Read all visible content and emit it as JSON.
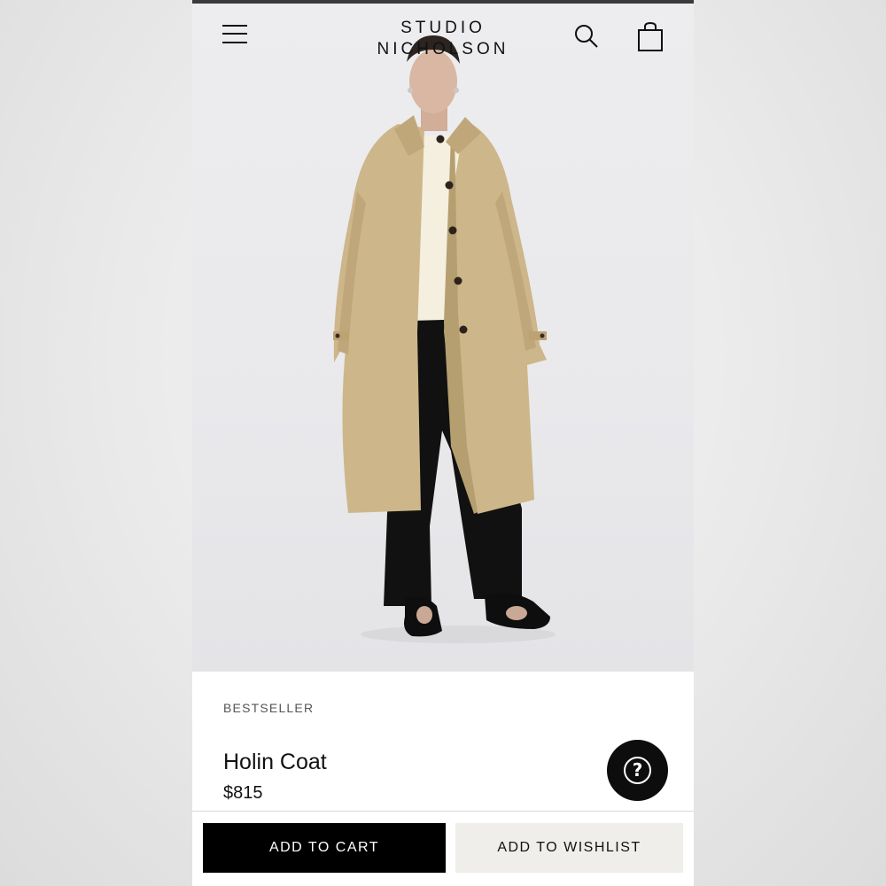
{
  "brand": {
    "line1": "STUDIO",
    "line2": "NICHOLSON"
  },
  "header": {
    "menu_icon": "hamburger-menu-icon",
    "search_icon": "search-icon",
    "cart_icon": "shopping-bag-icon"
  },
  "product": {
    "badge": "BESTSELLER",
    "name": "Holin Coat",
    "price": "$815",
    "image": "model-wearing-holin-coat"
  },
  "help": {
    "icon": "question-mark-icon",
    "glyph": "?"
  },
  "actions": {
    "add_to_cart": "ADD TO CART",
    "add_to_wishlist": "ADD TO WISHLIST"
  },
  "colors": {
    "primary_button": "#000000",
    "secondary_button": "#efeeea",
    "coat": "#cdb689",
    "background": "#ededef"
  }
}
